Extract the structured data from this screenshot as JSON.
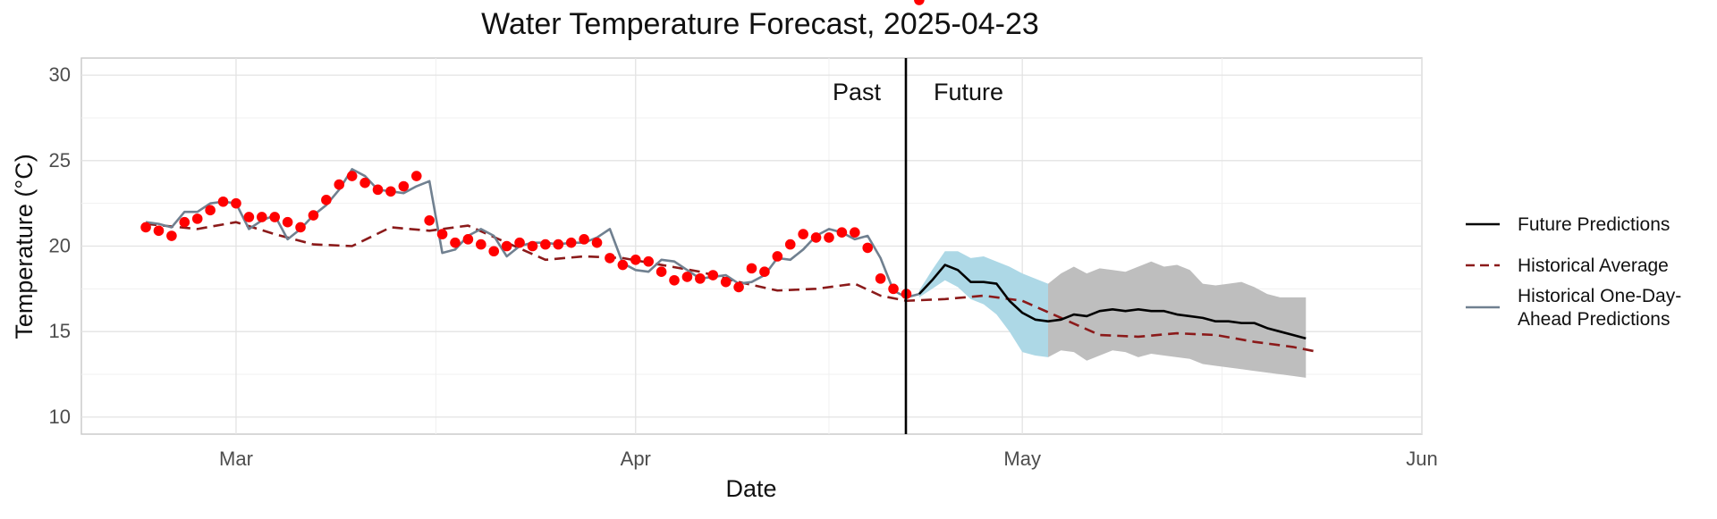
{
  "chart_data": {
    "type": "line",
    "title": "Water Temperature Forecast, 2025-04-23",
    "xlabel": "Date",
    "ylabel": "Temperature (°C)",
    "xlim": [
      "2025-02-17",
      "2025-06-01"
    ],
    "ylim": [
      9,
      31
    ],
    "x_ticks": [
      {
        "date": "2025-03-01",
        "label": "Mar"
      },
      {
        "date": "2025-04-01",
        "label": "Apr"
      },
      {
        "date": "2025-05-01",
        "label": "May"
      },
      {
        "date": "2025-06-01",
        "label": "Jun"
      }
    ],
    "y_ticks": [
      10,
      15,
      20,
      25,
      30
    ],
    "grid": true,
    "legend_position": "right",
    "forecast_date": "2025-04-23",
    "annotations": {
      "past": "Past",
      "future": "Future"
    },
    "colors": {
      "future": "#000000",
      "historical_avg": "#8b1a1a",
      "one_day_ahead": "#708090",
      "observed": "#ff0000",
      "near_band": "#add8e6",
      "far_band": "#bebebe",
      "divider": "#000000"
    },
    "series": [
      {
        "name": "Historical Average",
        "style": "dashed",
        "x": [
          "2025-02-22",
          "2025-02-26",
          "2025-03-01",
          "2025-03-04",
          "2025-03-07",
          "2025-03-10",
          "2025-03-13",
          "2025-03-16",
          "2025-03-19",
          "2025-03-22",
          "2025-03-25",
          "2025-03-28",
          "2025-03-31",
          "2025-04-03",
          "2025-04-06",
          "2025-04-09",
          "2025-04-12",
          "2025-04-15",
          "2025-04-18",
          "2025-04-20",
          "2025-04-22",
          "2025-04-25",
          "2025-04-28",
          "2025-05-01",
          "2025-05-04",
          "2025-05-07",
          "2025-05-10",
          "2025-05-13",
          "2025-05-16",
          "2025-05-19",
          "2025-05-22",
          "2025-05-24"
        ],
        "y": [
          21.3,
          21.0,
          21.4,
          20.7,
          20.1,
          20.0,
          21.1,
          20.9,
          21.2,
          20.2,
          19.2,
          19.4,
          19.3,
          18.9,
          18.5,
          17.9,
          17.4,
          17.5,
          17.8,
          17.1,
          16.8,
          16.9,
          17.1,
          16.8,
          15.8,
          14.8,
          14.7,
          14.9,
          14.8,
          14.4,
          14.1,
          13.8
        ]
      },
      {
        "name": "Historical One-Day-Ahead Predictions",
        "style": "solid",
        "x": [
          "2025-02-22",
          "2025-02-23",
          "2025-02-24",
          "2025-02-25",
          "2025-02-26",
          "2025-02-27",
          "2025-02-28",
          "2025-03-01",
          "2025-03-02",
          "2025-03-03",
          "2025-03-04",
          "2025-03-05",
          "2025-03-06",
          "2025-03-07",
          "2025-03-08",
          "2025-03-09",
          "2025-03-10",
          "2025-03-11",
          "2025-03-12",
          "2025-03-13",
          "2025-03-14",
          "2025-03-15",
          "2025-03-16",
          "2025-03-17",
          "2025-03-18",
          "2025-03-19",
          "2025-03-20",
          "2025-03-21",
          "2025-03-22",
          "2025-03-23",
          "2025-03-24",
          "2025-03-25",
          "2025-03-26",
          "2025-03-27",
          "2025-03-28",
          "2025-03-29",
          "2025-03-30",
          "2025-03-31",
          "2025-04-01",
          "2025-04-02",
          "2025-04-03",
          "2025-04-04",
          "2025-04-05",
          "2025-04-06",
          "2025-04-07",
          "2025-04-08",
          "2025-04-09",
          "2025-04-10",
          "2025-04-11",
          "2025-04-12",
          "2025-04-13",
          "2025-04-14",
          "2025-04-15",
          "2025-04-16",
          "2025-04-17",
          "2025-04-18",
          "2025-04-19",
          "2025-04-20",
          "2025-04-21",
          "2025-04-22",
          "2025-04-23"
        ],
        "y": [
          21.4,
          21.3,
          21.1,
          22.0,
          22.0,
          22.5,
          22.6,
          22.5,
          21.0,
          21.5,
          21.8,
          20.4,
          21.0,
          21.8,
          22.4,
          23.3,
          24.5,
          24.1,
          23.3,
          23.2,
          23.1,
          23.5,
          23.8,
          19.6,
          19.8,
          20.6,
          21.0,
          20.6,
          19.4,
          20.0,
          20.2,
          20.2,
          20.1,
          20.2,
          20.2,
          20.5,
          21.0,
          19.0,
          18.6,
          18.5,
          19.2,
          19.1,
          18.6,
          18.1,
          18.2,
          18.3,
          17.8,
          17.9,
          18.3,
          19.3,
          19.2,
          19.8,
          20.6,
          21.0,
          20.8,
          20.4,
          20.6,
          19.3,
          17.4,
          17.0,
          17.2
        ]
      },
      {
        "name": "Future Predictions",
        "style": "solid",
        "x": [
          "2025-04-23",
          "2025-04-24",
          "2025-04-25",
          "2025-04-26",
          "2025-04-27",
          "2025-04-28",
          "2025-04-29",
          "2025-04-30",
          "2025-05-01",
          "2025-05-02",
          "2025-05-03",
          "2025-05-04",
          "2025-05-05",
          "2025-05-06",
          "2025-05-07",
          "2025-05-08",
          "2025-05-09",
          "2025-05-10",
          "2025-05-11",
          "2025-05-12",
          "2025-05-13",
          "2025-05-14",
          "2025-05-15",
          "2025-05-16",
          "2025-05-17",
          "2025-05-18",
          "2025-05-19",
          "2025-05-20",
          "2025-05-21",
          "2025-05-22",
          "2025-05-23"
        ],
        "y": [
          17.2,
          18.0,
          18.9,
          18.6,
          17.9,
          17.9,
          17.8,
          16.8,
          16.1,
          15.7,
          15.6,
          15.7,
          16.0,
          15.9,
          16.2,
          16.3,
          16.2,
          16.3,
          16.2,
          16.2,
          16.0,
          15.9,
          15.8,
          15.6,
          15.6,
          15.5,
          15.5,
          15.2,
          15.0,
          14.8,
          14.6
        ]
      }
    ],
    "observed": {
      "x": [
        "2025-02-22",
        "2025-02-23",
        "2025-02-24",
        "2025-02-25",
        "2025-02-26",
        "2025-02-27",
        "2025-02-28",
        "2025-03-01",
        "2025-03-02",
        "2025-03-03",
        "2025-03-04",
        "2025-03-05",
        "2025-03-06",
        "2025-03-07",
        "2025-03-08",
        "2025-03-09",
        "2025-03-10",
        "2025-03-11",
        "2025-03-12",
        "2025-03-13",
        "2025-03-14",
        "2025-03-15",
        "2025-03-16",
        "2025-03-17",
        "2025-03-18",
        "2025-03-19",
        "2025-03-20",
        "2025-03-21",
        "2025-03-22",
        "2025-03-23",
        "2025-03-24",
        "2025-03-25",
        "2025-03-26",
        "2025-03-27",
        "2025-03-28",
        "2025-03-29",
        "2025-03-30",
        "2025-03-31",
        "2025-04-01",
        "2025-04-02",
        "2025-04-03",
        "2025-04-04",
        "2025-04-05",
        "2025-04-06",
        "2025-04-07",
        "2025-04-08",
        "2025-04-09",
        "2025-04-10",
        "2025-04-11",
        "2025-04-12",
        "2025-04-13",
        "2025-04-14",
        "2025-04-15",
        "2025-04-16",
        "2025-04-17",
        "2025-04-18",
        "2025-04-19",
        "2025-04-20",
        "2025-04-21",
        "2025-04-22",
        "2025-04-23"
      ],
      "y": [
        21.1,
        20.9,
        20.6,
        21.4,
        21.6,
        22.1,
        22.6,
        22.5,
        21.7,
        21.7,
        21.7,
        21.4,
        21.1,
        21.8,
        22.7,
        23.6,
        24.1,
        23.7,
        23.3,
        23.2,
        23.5,
        24.1,
        21.5,
        20.7,
        20.2,
        20.4,
        20.1,
        19.7,
        20.0,
        20.2,
        20.0,
        20.1,
        20.1,
        20.2,
        20.4,
        20.2,
        19.3,
        18.9,
        19.2,
        19.1,
        18.5,
        18.0,
        18.2,
        18.1,
        18.3,
        17.9,
        17.6,
        18.7,
        18.5,
        19.4,
        20.1,
        20.7,
        20.5,
        20.5,
        20.8,
        20.8,
        19.9,
        18.1,
        17.5,
        17.2
      ]
    },
    "bands": [
      {
        "name": "near",
        "x": [
          "2025-04-23",
          "2025-04-24",
          "2025-04-25",
          "2025-04-26",
          "2025-04-27",
          "2025-04-28",
          "2025-04-29",
          "2025-04-30",
          "2025-05-01",
          "2025-05-02",
          "2025-05-03"
        ],
        "lower": [
          17.0,
          17.5,
          18.0,
          17.6,
          16.9,
          16.6,
          16.0,
          15.0,
          13.8,
          13.6,
          13.5
        ],
        "upper": [
          17.4,
          18.6,
          19.7,
          19.7,
          19.3,
          19.4,
          19.1,
          18.8,
          18.4,
          18.1,
          17.8
        ]
      },
      {
        "name": "far",
        "x": [
          "2025-05-03",
          "2025-05-04",
          "2025-05-05",
          "2025-05-06",
          "2025-05-07",
          "2025-05-08",
          "2025-05-09",
          "2025-05-10",
          "2025-05-11",
          "2025-05-12",
          "2025-05-13",
          "2025-05-14",
          "2025-05-15",
          "2025-05-16",
          "2025-05-17",
          "2025-05-18",
          "2025-05-19",
          "2025-05-20",
          "2025-05-21",
          "2025-05-22",
          "2025-05-23"
        ],
        "lower": [
          13.5,
          13.9,
          13.8,
          13.3,
          13.6,
          13.9,
          13.8,
          13.5,
          13.7,
          13.6,
          13.5,
          13.4,
          13.1,
          13.0,
          12.9,
          12.8,
          12.7,
          12.6,
          12.5,
          12.4,
          12.3
        ],
        "upper": [
          17.8,
          18.4,
          18.8,
          18.4,
          18.7,
          18.6,
          18.5,
          18.8,
          19.1,
          18.8,
          18.9,
          18.6,
          17.8,
          17.7,
          17.8,
          17.9,
          17.6,
          17.2,
          17.0,
          17.0,
          17.0
        ]
      }
    ]
  },
  "legend": [
    {
      "label": "Future Predictions",
      "style": "solid",
      "color": "#000000"
    },
    {
      "label": "Historical Average",
      "style": "dashed",
      "color": "#8b1a1a"
    },
    {
      "label": "Historical One-Day-",
      "label2": "Ahead Predictions",
      "style": "solid",
      "color": "#708090"
    }
  ]
}
